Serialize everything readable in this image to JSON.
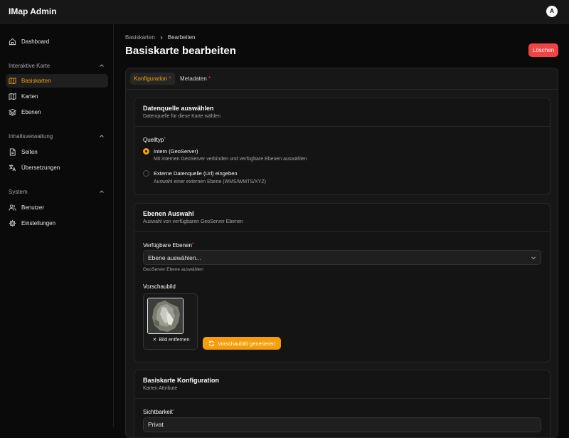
{
  "app": {
    "title": "IMap Admin",
    "user_initial": "A"
  },
  "sidebar": {
    "dashboard": "Dashboard",
    "groups": [
      {
        "title": "Interaktive Karte",
        "items": [
          {
            "label": "Basiskarten",
            "icon": "map-icon",
            "active": true
          },
          {
            "label": "Karten",
            "icon": "map-fold-icon"
          },
          {
            "label": "Ebenen",
            "icon": "layers-icon"
          }
        ]
      },
      {
        "title": "Inhaltsverwaltung",
        "items": [
          {
            "label": "Seiten",
            "icon": "file-icon"
          },
          {
            "label": "Übersetzungen",
            "icon": "languages-icon"
          }
        ]
      },
      {
        "title": "System",
        "items": [
          {
            "label": "Benutzer",
            "icon": "users-icon"
          },
          {
            "label": "Einstellungen",
            "icon": "gear-icon"
          }
        ]
      }
    ]
  },
  "breadcrumb": {
    "parent": "Basiskarten",
    "current": "Bearbeiten"
  },
  "page": {
    "title": "Basiskarte bearbeiten",
    "delete_label": "Löschen"
  },
  "tabs": [
    {
      "label": "Konfiguration",
      "required": "*"
    },
    {
      "label": "Metadaten",
      "required": "*"
    }
  ],
  "datasource": {
    "title": "Datenquelle auswählen",
    "subtitle": "Datenquelle für diese Karte wählen",
    "field_label": "Quelltyp",
    "required": "*",
    "options": [
      {
        "title": "Intern (GeoServer)",
        "desc": "Mit internen GeoServer verbinden und verfügbare Ebenen auswählen",
        "selected": true
      },
      {
        "title": "Externe Datenquelle (Url) eingeben",
        "desc": "Auswahl einer externen Ebene (WMS/WMTS/XYZ)",
        "selected": false
      }
    ]
  },
  "layers": {
    "title": "Ebenen Auswahl",
    "subtitle": "Auswahl von verfügbaren GeoServer Ebenen",
    "field_label": "Verfügbare Ebenen",
    "required": "*",
    "select_value": "Ebene auswählen...",
    "hint": "GeoServer Ebene auswählen",
    "preview_label": "Vorschaubild",
    "remove_label": "Bild entfernen",
    "generate_label": "Vorschaubild generieren"
  },
  "config": {
    "title": "Basiskarte Konfiguration",
    "subtitle": "Karten Attribute",
    "visibility_label": "Sichtbarkeit",
    "required": "*",
    "visibility_value": "Privat"
  },
  "colors": {
    "accent": "#f59e0b",
    "danger": "#ef4444",
    "background": "#0a0a0a",
    "panel": "#171717"
  }
}
